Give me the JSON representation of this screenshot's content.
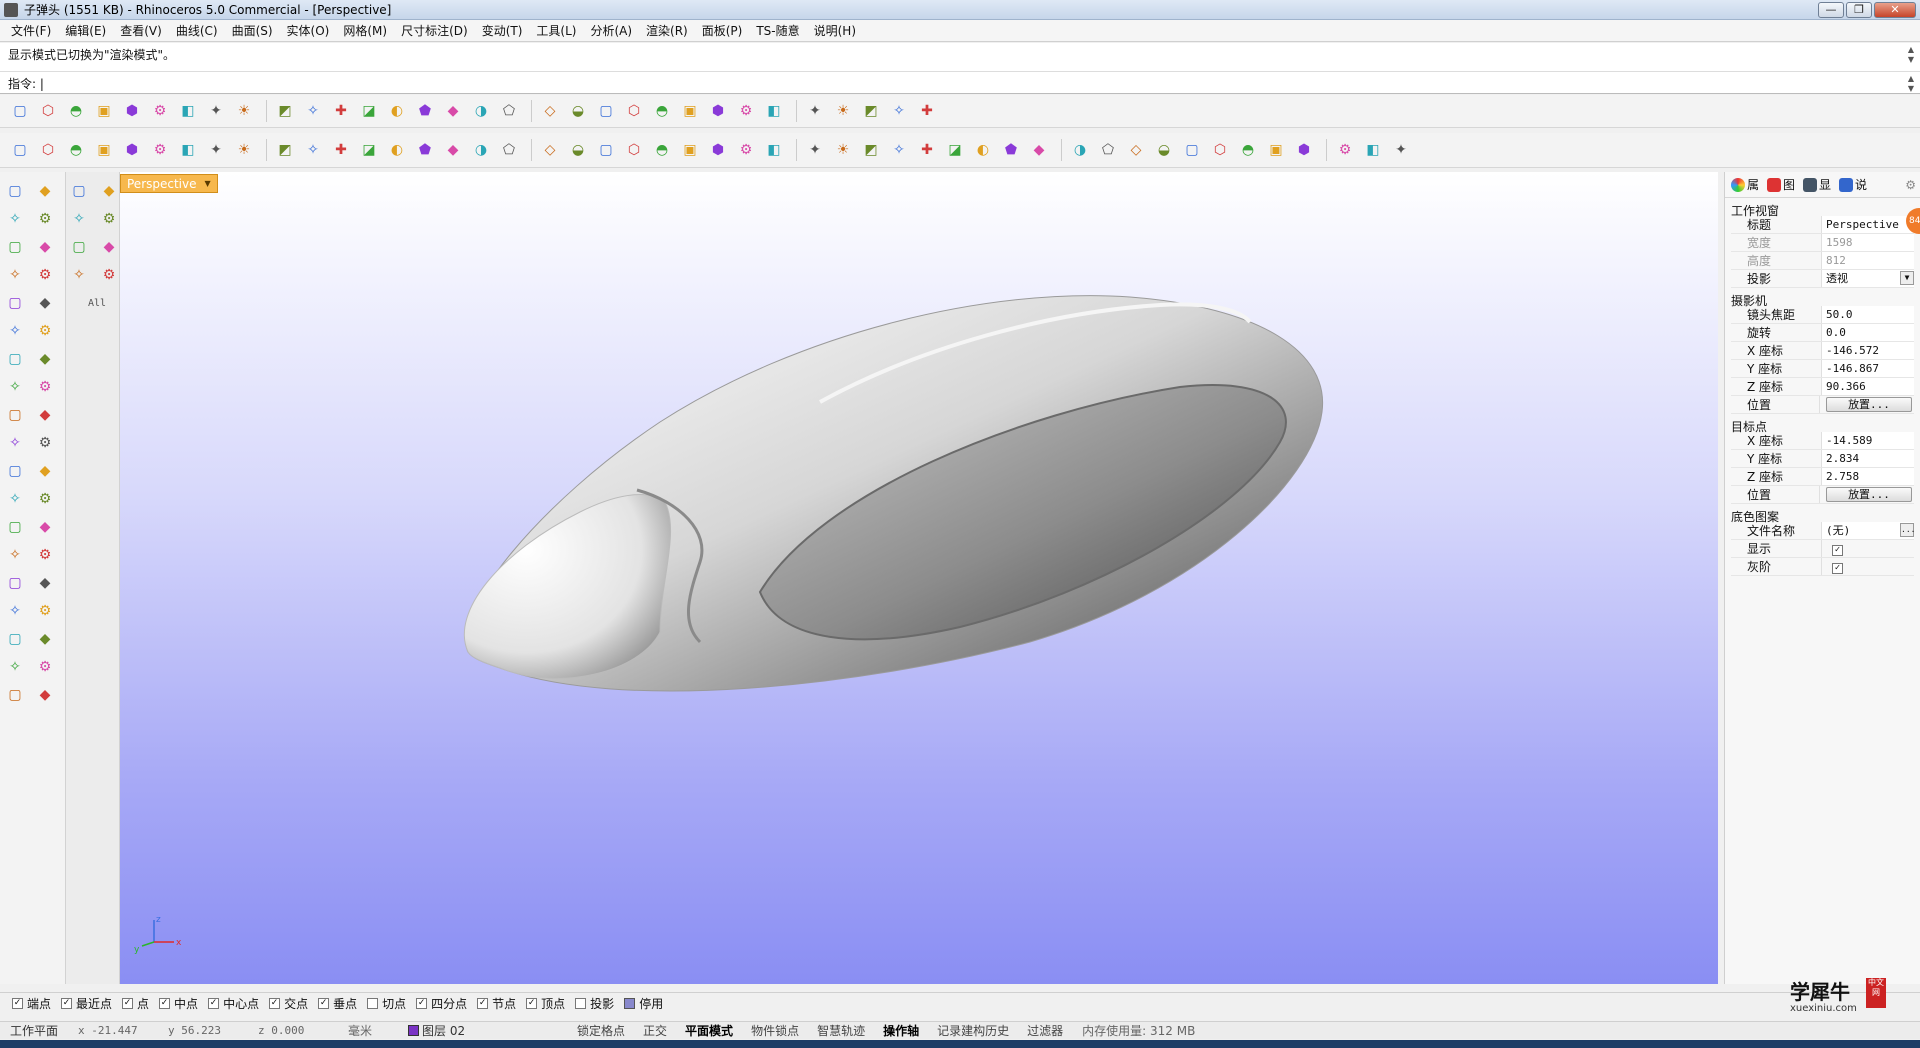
{
  "window": {
    "title": "子弹头 (1551 KB) - Rhinoceros 5.0 Commercial - [Perspective]",
    "minimize": "—",
    "maximize": "❐",
    "close": "✕"
  },
  "menu": [
    "文件(F)",
    "编辑(E)",
    "查看(V)",
    "曲线(C)",
    "曲面(S)",
    "实体(O)",
    "网格(M)",
    "尺寸标注(D)",
    "变动(T)",
    "工具(L)",
    "分析(A)",
    "渲染(R)",
    "面板(P)",
    "TS-随意",
    "说明(H)"
  ],
  "command": {
    "history": "显示模式已切换为\"渲染模式\"。",
    "prompt": "指令: |"
  },
  "viewport": {
    "tab_label": "Perspective",
    "axis_x": "x",
    "axis_y": "y",
    "axis_z": "z"
  },
  "left_tools2": {
    "all_label": "All"
  },
  "right_panel": {
    "tabs": [
      "属",
      "图",
      "显",
      "说"
    ],
    "badge": "84",
    "sections": {
      "viewport": "工作视窗",
      "camera": "摄影机",
      "target": "目标点",
      "wallpaper": "底色图案"
    },
    "rows": {
      "title": {
        "k": "标题",
        "v": "Perspective"
      },
      "width": {
        "k": "宽度",
        "v": "1598"
      },
      "height": {
        "k": "高度",
        "v": "812"
      },
      "projection": {
        "k": "投影",
        "v": "透视"
      },
      "lens": {
        "k": "镜头焦距",
        "v": "50.0"
      },
      "rotation": {
        "k": "旋转",
        "v": "0.0"
      },
      "cam_x": {
        "k": "X 座标",
        "v": "-146.572"
      },
      "cam_y": {
        "k": "Y 座标",
        "v": "-146.867"
      },
      "cam_z": {
        "k": "Z 座标",
        "v": "90.366"
      },
      "cam_pos": {
        "k": "位置",
        "v": "放置..."
      },
      "tgt_x": {
        "k": "X 座标",
        "v": "-14.589"
      },
      "tgt_y": {
        "k": "Y 座标",
        "v": "2.834"
      },
      "tgt_z": {
        "k": "Z 座标",
        "v": "2.758"
      },
      "tgt_pos": {
        "k": "位置",
        "v": "放置..."
      },
      "filename": {
        "k": "文件名称",
        "v": "(无)",
        "btn": "..."
      },
      "show": {
        "k": "显示",
        "v": "☑"
      },
      "gray": {
        "k": "灰阶",
        "v": "☑"
      }
    }
  },
  "osnap": [
    {
      "label": "端点",
      "mark": "✓"
    },
    {
      "label": "最近点",
      "mark": "✓"
    },
    {
      "label": "点",
      "mark": "✓"
    },
    {
      "label": "中点",
      "mark": "✓"
    },
    {
      "label": "中心点",
      "mark": "✓"
    },
    {
      "label": "交点",
      "mark": "✓"
    },
    {
      "label": "垂点",
      "mark": "✓"
    },
    {
      "label": "切点",
      "mark": ""
    },
    {
      "label": "四分点",
      "mark": "✓"
    },
    {
      "label": "节点",
      "mark": "✓"
    },
    {
      "label": "顶点",
      "mark": "✓"
    },
    {
      "label": "投影",
      "mark": ""
    },
    {
      "label": "停用",
      "mark": ""
    }
  ],
  "status": {
    "cplane": "工作平面",
    "x": "x -21.447",
    "y": "y 56.223",
    "z": "z 0.000",
    "unit": "毫米",
    "layer": "图层 02",
    "modes": [
      "锁定格点",
      "正交",
      "平面模式",
      "物件锁点",
      "智慧轨迹",
      "操作轴",
      "记录建构历史",
      "过滤器"
    ],
    "memory": "内存使用量: 312 MB"
  },
  "watermark": {
    "title": "学犀牛",
    "url": "xuexiniu.com",
    "seal": "中文网"
  },
  "colors": {
    "viewport_tab": "#f7b84d",
    "layer_color": "#7a33c4",
    "badge": "#f07b2a"
  }
}
